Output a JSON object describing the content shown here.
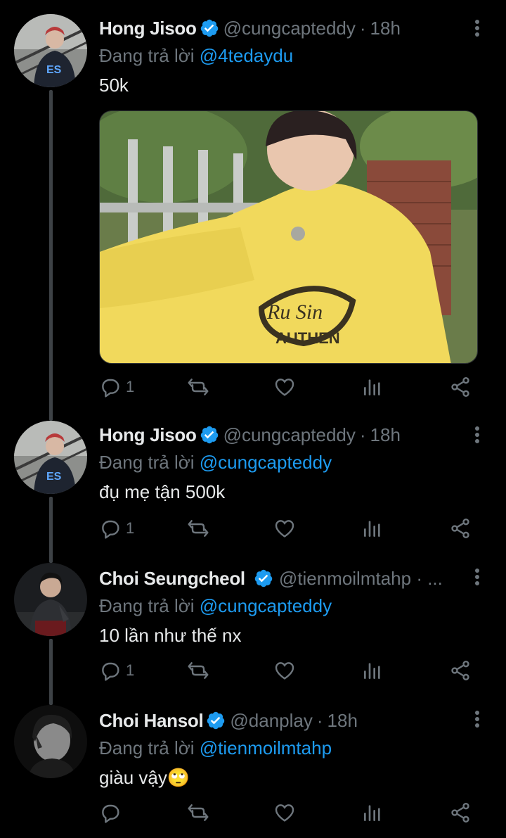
{
  "colors": {
    "background": "#000000",
    "text": "#e7e9ea",
    "muted": "#6e767d",
    "link": "#1d9bf0",
    "verified": "#1d9bf0",
    "thread_line": "#3d4246"
  },
  "tweets": [
    {
      "name": "Hong Jisoo",
      "handle": "@cungcapteddy",
      "separator": "·",
      "time": "18h",
      "reply_prefix": "Đang trả lời ",
      "reply_to": "@4tedaydu",
      "text": "50k",
      "has_media": true,
      "reply_count": "1"
    },
    {
      "name": "Hong Jisoo",
      "handle": "@cungcapteddy",
      "separator": "·",
      "time": "18h",
      "reply_prefix": "Đang trả lời ",
      "reply_to": "@cungcapteddy",
      "text": "đụ mẹ tận 500k",
      "reply_count": "1"
    },
    {
      "name": "Choi Seungcheol",
      "handle": "@tienmoilmtahp · ...",
      "reply_prefix": "Đang trả lời ",
      "reply_to": "@cungcapteddy",
      "text": "10 lần như thế nx",
      "reply_count": "1"
    },
    {
      "name": "Choi Hansol",
      "handle": "@danplay",
      "separator": "·",
      "time": "18h",
      "reply_prefix": "Đang trả lời ",
      "reply_to": "@tienmoilmtahp",
      "text": "giàu vậy🙄",
      "reply_count": ""
    }
  ],
  "icons": {
    "reply": "reply-icon",
    "retweet": "retweet-icon",
    "like": "heart-icon",
    "analytics": "analytics-icon",
    "share": "share-icon",
    "more": "more-vertical-icon",
    "verified": "verified-badge-icon"
  }
}
